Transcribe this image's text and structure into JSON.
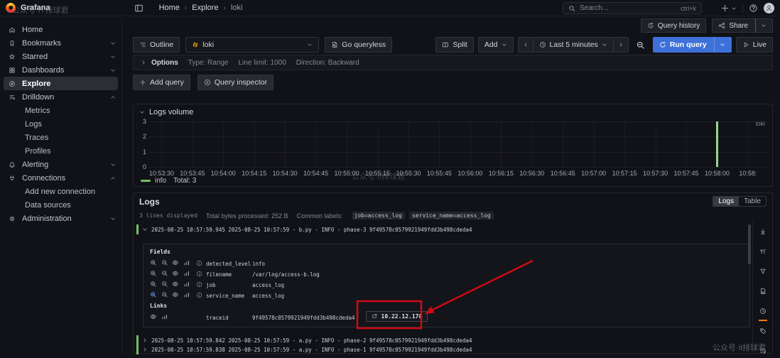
{
  "watermark": {
    "top_left": "公众号·IT排球君",
    "chart": "公众号·it排球君",
    "bottom_right": "公众号·it排球君"
  },
  "topnav": {
    "brand": "Grafana",
    "breadcrumb": [
      "Home",
      "Explore",
      "loki"
    ],
    "search": {
      "placeholder": "Search...",
      "shortcut": "ctrl+k"
    }
  },
  "secondary_bar": {
    "query_history": "Query history",
    "share": "Share"
  },
  "sidebar": {
    "items": [
      {
        "label": "Home",
        "icon": "home",
        "level": 0
      },
      {
        "label": "Bookmarks",
        "icon": "bookmark",
        "level": 0,
        "chevron": "down"
      },
      {
        "label": "Starred",
        "icon": "star",
        "level": 0,
        "chevron": "down"
      },
      {
        "label": "Dashboards",
        "icon": "grid",
        "level": 0,
        "chevron": "down"
      },
      {
        "label": "Explore",
        "icon": "compass",
        "level": 0,
        "active": true
      },
      {
        "label": "Drilldown",
        "icon": "drilldown",
        "level": 0,
        "chevron": "up"
      },
      {
        "label": "Metrics",
        "level": 1
      },
      {
        "label": "Logs",
        "level": 1
      },
      {
        "label": "Traces",
        "level": 1
      },
      {
        "label": "Profiles",
        "level": 1
      },
      {
        "label": "Alerting",
        "icon": "bell",
        "level": 0,
        "chevron": "down"
      },
      {
        "label": "Connections",
        "icon": "plug",
        "level": 0,
        "chevron": "up"
      },
      {
        "label": "Add new connection",
        "level": 1
      },
      {
        "label": "Data sources",
        "level": 1
      },
      {
        "label": "Administration",
        "icon": "gear",
        "level": 0,
        "chevron": "down"
      }
    ]
  },
  "toolbar": {
    "outline": "Outline",
    "datasource": "loki",
    "go_queryless": "Go queryless",
    "split": "Split",
    "add": "Add",
    "time_range": "Last 5 minutes",
    "run_query": "Run query",
    "live": "Live"
  },
  "query_editor": {
    "options_label": "Options",
    "options_items": [
      "Type: Range",
      "Line limit: 1000",
      "Direction: Backward"
    ],
    "add_query": "Add query",
    "query_inspector": "Query inspector"
  },
  "chart_data": {
    "type": "bar",
    "title": "Logs volume",
    "panel_series_label": "loki",
    "x_ticks": [
      "10:53:30",
      "10:53:45",
      "10:54:00",
      "10:54:15",
      "10:54:30",
      "10:54:45",
      "10:55:00",
      "10:55:15",
      "10:55:30",
      "10:55:45",
      "10:56:00",
      "10:56:15",
      "10:56:30",
      "10:56:45",
      "10:57:00",
      "10:57:15",
      "10:57:30",
      "10:57:45",
      "10:58:00",
      "10:58:"
    ],
    "y_ticks": [
      3,
      2,
      1,
      0
    ],
    "ylim": [
      0,
      3
    ],
    "grid": true,
    "legend_position": "bottom-left",
    "series": [
      {
        "name": "info",
        "color": "#96d98d",
        "total": 3,
        "points": [
          {
            "x": "10:58:00",
            "y": 3
          }
        ]
      }
    ],
    "legend": {
      "label": "info",
      "total": "Total: 3"
    }
  },
  "logs": {
    "title": "Logs",
    "meta": {
      "lines": "3 lines displayed",
      "bytes": "Total bytes processed: 252 B",
      "common_labels_label": "Common labels:",
      "common_labels": [
        "job=access_log",
        "service_name=access_log"
      ]
    },
    "view_toggle": {
      "options": [
        "Logs",
        "Table"
      ],
      "selected": "Logs"
    },
    "rows": [
      {
        "expanded": true,
        "level_color": "#73bf69",
        "text": "2025-08-25 10:57:59.945 2025-08-25 10:57:59 - b.py - INFO - phase-3 9f49578c0579921949fdd3b498cdeda4"
      },
      {
        "expanded": false,
        "level_color": "#73bf69",
        "text": "2025-08-25 10:57:59.842 2025-08-25 10:57:59 - a.py - INFO - phase-2 9f49578c0579921949fdd3b498cdeda4"
      },
      {
        "expanded": false,
        "level_color": "#73bf69",
        "text": "2025-08-25 10:57:59.838 2025-08-25 10:57:59 - a.py - INFO - phase-1 9f49578c0579921949fdd3b498cdeda4"
      }
    ],
    "details": {
      "fields_title": "Fields",
      "fields": [
        {
          "name": "detected_level",
          "value": "info"
        },
        {
          "name": "filename",
          "value": "/var/log/access-b.log"
        },
        {
          "name": "job",
          "value": "access_log"
        },
        {
          "name": "service_name",
          "value": "access_log",
          "highlight": true
        }
      ],
      "links_title": "Links",
      "links": [
        {
          "name": "traceid",
          "value": "9f49578c0579921949fdd3b498cdeda4",
          "link_button": "10.22.12.178"
        }
      ]
    },
    "control_icons": [
      {
        "icon": "scroll-down"
      },
      {
        "icon": "sort-logs"
      },
      {
        "icon": "filter"
      },
      {
        "icon": "log-file"
      },
      {
        "icon": "clock",
        "active": true
      },
      {
        "icon": "tag"
      },
      {
        "icon": "wrap-lines"
      }
    ]
  },
  "colors": {
    "accent_blue": "#3d71d9",
    "level_green": "#73bf69",
    "bar_green": "#96d98d",
    "annotation_red": "#cf0a14",
    "active_orange": "#ff780a"
  }
}
